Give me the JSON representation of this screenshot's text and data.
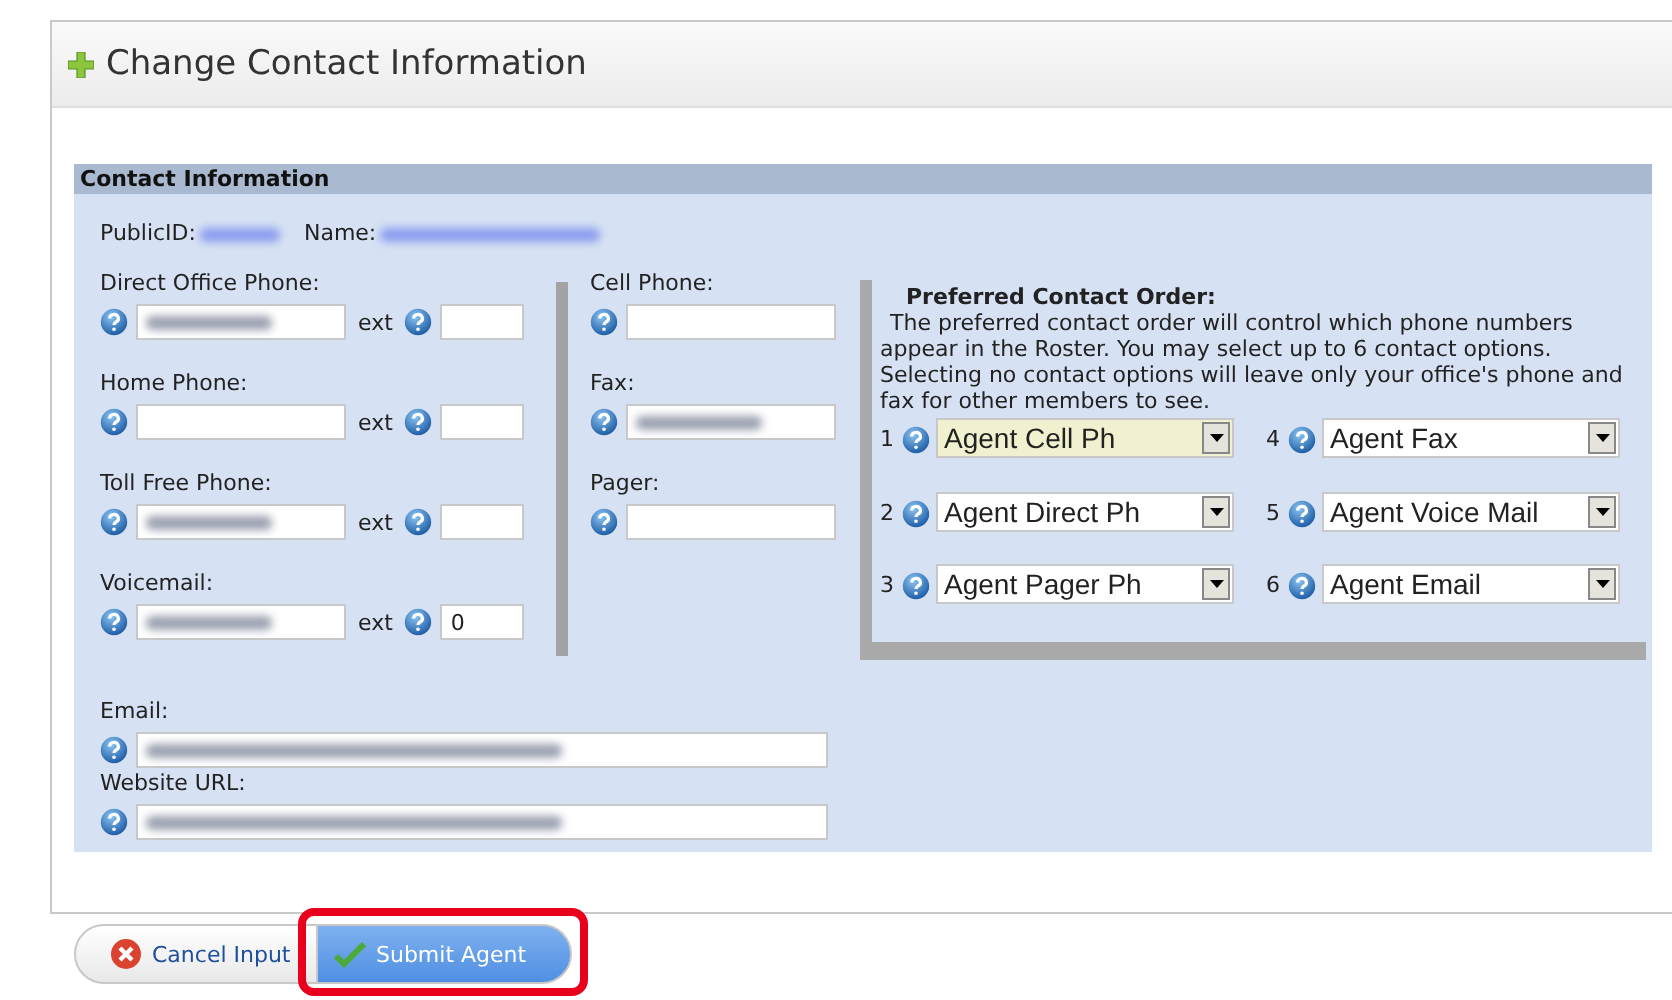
{
  "panel": {
    "title": "Change Contact Information"
  },
  "section": {
    "title": "Contact Information",
    "identity": [
      {
        "label": "PublicID:",
        "redacted": true
      },
      {
        "label": "Name:",
        "redacted": true
      }
    ],
    "left_fields": [
      {
        "label": "Direct Office Phone:",
        "redacted": true,
        "ext": {
          "label": "ext"
        }
      },
      {
        "label": "Home Phone:",
        "redacted": false,
        "ext": {
          "label": "ext"
        }
      },
      {
        "label": "Toll Free Phone:",
        "redacted": true,
        "ext": {
          "label": "ext"
        }
      },
      {
        "label": "Voicemail:",
        "redacted": true,
        "ext": {
          "label": "ext",
          "value": "0"
        }
      }
    ],
    "right_fields": [
      {
        "label": "Cell Phone:",
        "redacted": false
      },
      {
        "label": "Fax:",
        "redacted": true
      },
      {
        "label": "Pager:",
        "redacted": false
      }
    ],
    "wide_fields": [
      {
        "label": "Email:",
        "redacted": true
      },
      {
        "label": "Website URL:",
        "redacted": true
      }
    ],
    "order": {
      "title": "Preferred Contact Order:",
      "text": "The preferred contact order will control which phone numbers appear in the Roster.  You may select up to 6 contact options. Selecting no contact options will leave only your office's phone and fax for other members to see.",
      "selects": [
        {
          "number": "1",
          "value": "Agent Cell Ph",
          "highlighted": true
        },
        {
          "number": "2",
          "value": "Agent Direct Ph",
          "highlighted": false
        },
        {
          "number": "3",
          "value": "Agent Pager Ph",
          "highlighted": false
        },
        {
          "number": "4",
          "value": "Agent Fax",
          "highlighted": false
        },
        {
          "number": "5",
          "value": "Agent Voice Mail",
          "highlighted": false
        },
        {
          "number": "6",
          "value": "Agent Email",
          "highlighted": false
        }
      ]
    }
  },
  "buttons": [
    {
      "kind": "cancel",
      "label": "Cancel Input",
      "callout": false
    },
    {
      "kind": "submit",
      "label": "Submit Agent",
      "callout": true
    }
  ]
}
